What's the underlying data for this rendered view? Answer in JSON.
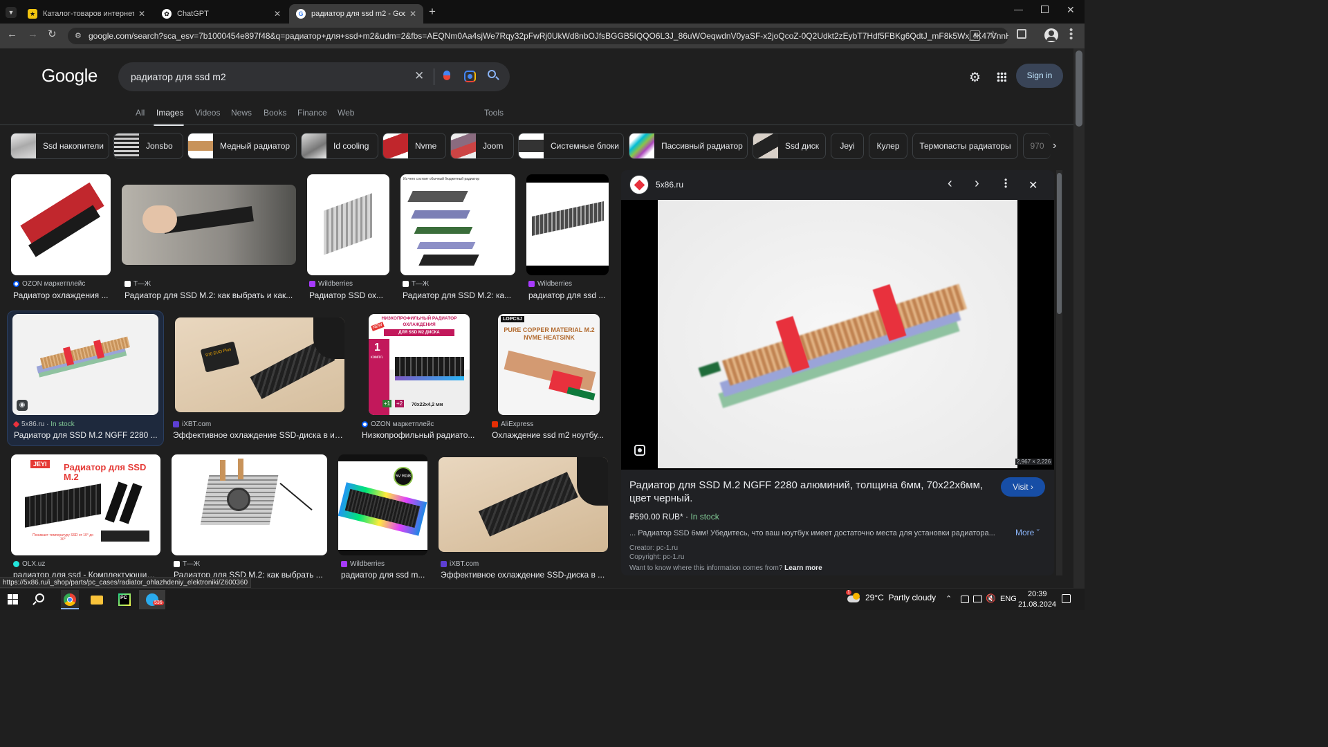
{
  "browser": {
    "tabs": [
      {
        "title": "Каталог-товаров интернет-магазин",
        "active": false
      },
      {
        "title": "ChatGPT",
        "active": false
      },
      {
        "title": "радиатор для ssd m2 - Google",
        "active": true
      }
    ],
    "url": "google.com/search?sca_esv=7b1000454e897f48&q=радиатор+для+ssd+m2&udm=2&fbs=AEQNm0Aa4sjWe7Rqy32pFwRj0UkWd8nbOJfsBGGB5IQQO6L3J_86uWOeqwdnV0yaSF-x2joQcoZ-0Q2Udkt2zEybT7Hdf5FBKg6QdtJ_mF8k5Wx_fK47VnnH0hq..."
  },
  "google": {
    "logo": "Google",
    "query": "радиатор для ssd m2",
    "sign_in": "Sign in",
    "nav": [
      "All",
      "Images",
      "Videos",
      "News",
      "Books",
      "Finance",
      "Web"
    ],
    "tools": "Tools",
    "chips": [
      "Ssd накопители",
      "Jonsbo",
      "Медный радиатор",
      "Id cooling",
      "Nvme",
      "Joom",
      "Системные блоки",
      "Пассивный радиатор",
      "Ssd диск",
      "Jeyi",
      "Кулер",
      "Термопасты радиаторы",
      "970"
    ]
  },
  "results": [
    {
      "source": "OZON маркетплейс",
      "caption": "Радиатор охлаждения ..."
    },
    {
      "source": "Т—Ж",
      "caption": "Радиатор для SSD M.2: как выбрать и как..."
    },
    {
      "source": "Wildberries",
      "caption": "Радиатор SSD ох..."
    },
    {
      "source": "Т—Ж",
      "caption": "Радиатор для SSD M.2: ка..."
    },
    {
      "source": "Wildberries",
      "caption": "радиатор для ssd ..."
    },
    {
      "source": "5x86.ru",
      "stock": "In stock",
      "caption": "Радиатор для SSD M.2 NGFF 2280 ..."
    },
    {
      "source": "iXBT.com",
      "caption": "Эффективное охлаждение SSD-диска в ис..."
    },
    {
      "source": "OZON маркетплейс",
      "caption": "Низкопрофильный радиато..."
    },
    {
      "source": "AliExpress",
      "caption": "Охлаждение ssd m2 ноутбу..."
    },
    {
      "source": "OLX.uz",
      "caption": "радиатор для ssd - Комплектующие ..."
    },
    {
      "source": "Т—Ж",
      "caption": "Радиатор для SSD M.2: как выбрать ..."
    },
    {
      "source": "Wildberries",
      "caption": "радиатор для ssd m..."
    },
    {
      "source": "iXBT.com",
      "caption": "Эффективное охлаждение SSD-диска в ..."
    }
  ],
  "image_texts": {
    "ozon_banner_title": "НИЗКОПРОФИЛЬНЫЙ РАДИАТОР ОХЛАЖДЕНИЯ",
    "ozon_banner_sub": "ДЛЯ SSD M2 ДИСКА",
    "ozon_new": "NEW",
    "ozon_count": "1",
    "ozon_count_label": "компл.",
    "ozon_size": "70x22x4,2 мм",
    "ozon_plus1": "+1",
    "ozon_plus2": "+2",
    "ali_brand": "LOPCSJ",
    "ali_text": "PURE COPPER MATERIAL M.2 NVME HEATSINK",
    "jeyi_brand": "JEYI",
    "jeyi_title": "Радиатор для SSD M.2",
    "jeyi_sub": "Понижает температуру SSD от 10° до 30°",
    "rgb_badge": "5V RGB",
    "ssd_label": "970 EVO Plus",
    "diagram_title": "Из чего состоит обычный бюджетный радиатор"
  },
  "preview": {
    "site": "5x86.ru",
    "dimensions": "2,967 × 2,226",
    "title": "Радиатор для SSD M.2 NGFF 2280 алюминий, толщина 6мм, 70x22x6мм, цвет черный.",
    "visit": "Visit",
    "price": "₽590.00 RUB*",
    "stock": "In stock",
    "snippet": "... Радиатор SSD 6мм! Убедитесь, что ваш ноутбук имеет достаточно места для установки радиатора...",
    "more": "More",
    "creator": "Creator: pc-1.ru",
    "copyright": "Copyright: pc-1.ru",
    "info_q": "Want to know where this information comes from?",
    "learn_more": "Learn more"
  },
  "status_url": "https://5x86.ru/i_shop/parts/pc_cases/radiator_ohlazhdeniy_elektroniki/Z600360",
  "taskbar": {
    "weather_temp": "29°C",
    "weather_desc": "Partly cloudy",
    "lang": "ENG",
    "time": "20:39",
    "date": "21.08.2024",
    "telegram_badge": "536",
    "weather_badge": "1"
  },
  "colors": {
    "accent_blue": "#8ab4f8",
    "in_stock_green": "#81c995",
    "visit_bg": "#174ea6",
    "copper": "#c8935a",
    "red_band": "#e8313d"
  }
}
